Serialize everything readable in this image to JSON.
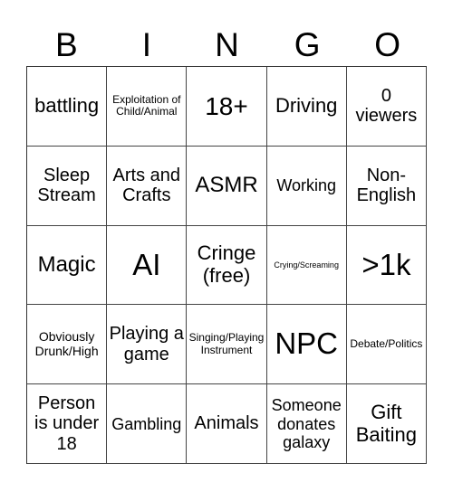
{
  "title_letters": [
    "B",
    "I",
    "N",
    "G",
    "O"
  ],
  "cells": [
    {
      "text": "battling",
      "size": "s22"
    },
    {
      "text": "Exploitation of Child/Animal",
      "size": "s12"
    },
    {
      "text": "18+",
      "size": "s28"
    },
    {
      "text": "Driving",
      "size": "s22"
    },
    {
      "text": "0 viewers",
      "size": "s20"
    },
    {
      "text": "Sleep Stream",
      "size": "s20"
    },
    {
      "text": "Arts and Crafts",
      "size": "s20"
    },
    {
      "text": "ASMR",
      "size": "s24"
    },
    {
      "text": "Working",
      "size": "s18"
    },
    {
      "text": "Non-English",
      "size": "s20"
    },
    {
      "text": "Magic",
      "size": "s24"
    },
    {
      "text": "AI",
      "size": "s33"
    },
    {
      "text": "Cringe (free)",
      "size": "s22"
    },
    {
      "text": "Crying/Screaming",
      "size": "s10"
    },
    {
      "text": ">1k",
      "size": "s33"
    },
    {
      "text": "Obviously Drunk/High",
      "size": "s14"
    },
    {
      "text": "Playing a game",
      "size": "s20"
    },
    {
      "text": "Singing/Playing Instrument",
      "size": "s12"
    },
    {
      "text": "NPC",
      "size": "s33"
    },
    {
      "text": "Debate/Politics",
      "size": "s12"
    },
    {
      "text": "Person is under 18",
      "size": "s20"
    },
    {
      "text": "Gambling",
      "size": "s18"
    },
    {
      "text": "Animals",
      "size": "s20"
    },
    {
      "text": "Someone donates galaxy",
      "size": "s18"
    },
    {
      "text": "Gift Baiting",
      "size": "s22"
    }
  ]
}
